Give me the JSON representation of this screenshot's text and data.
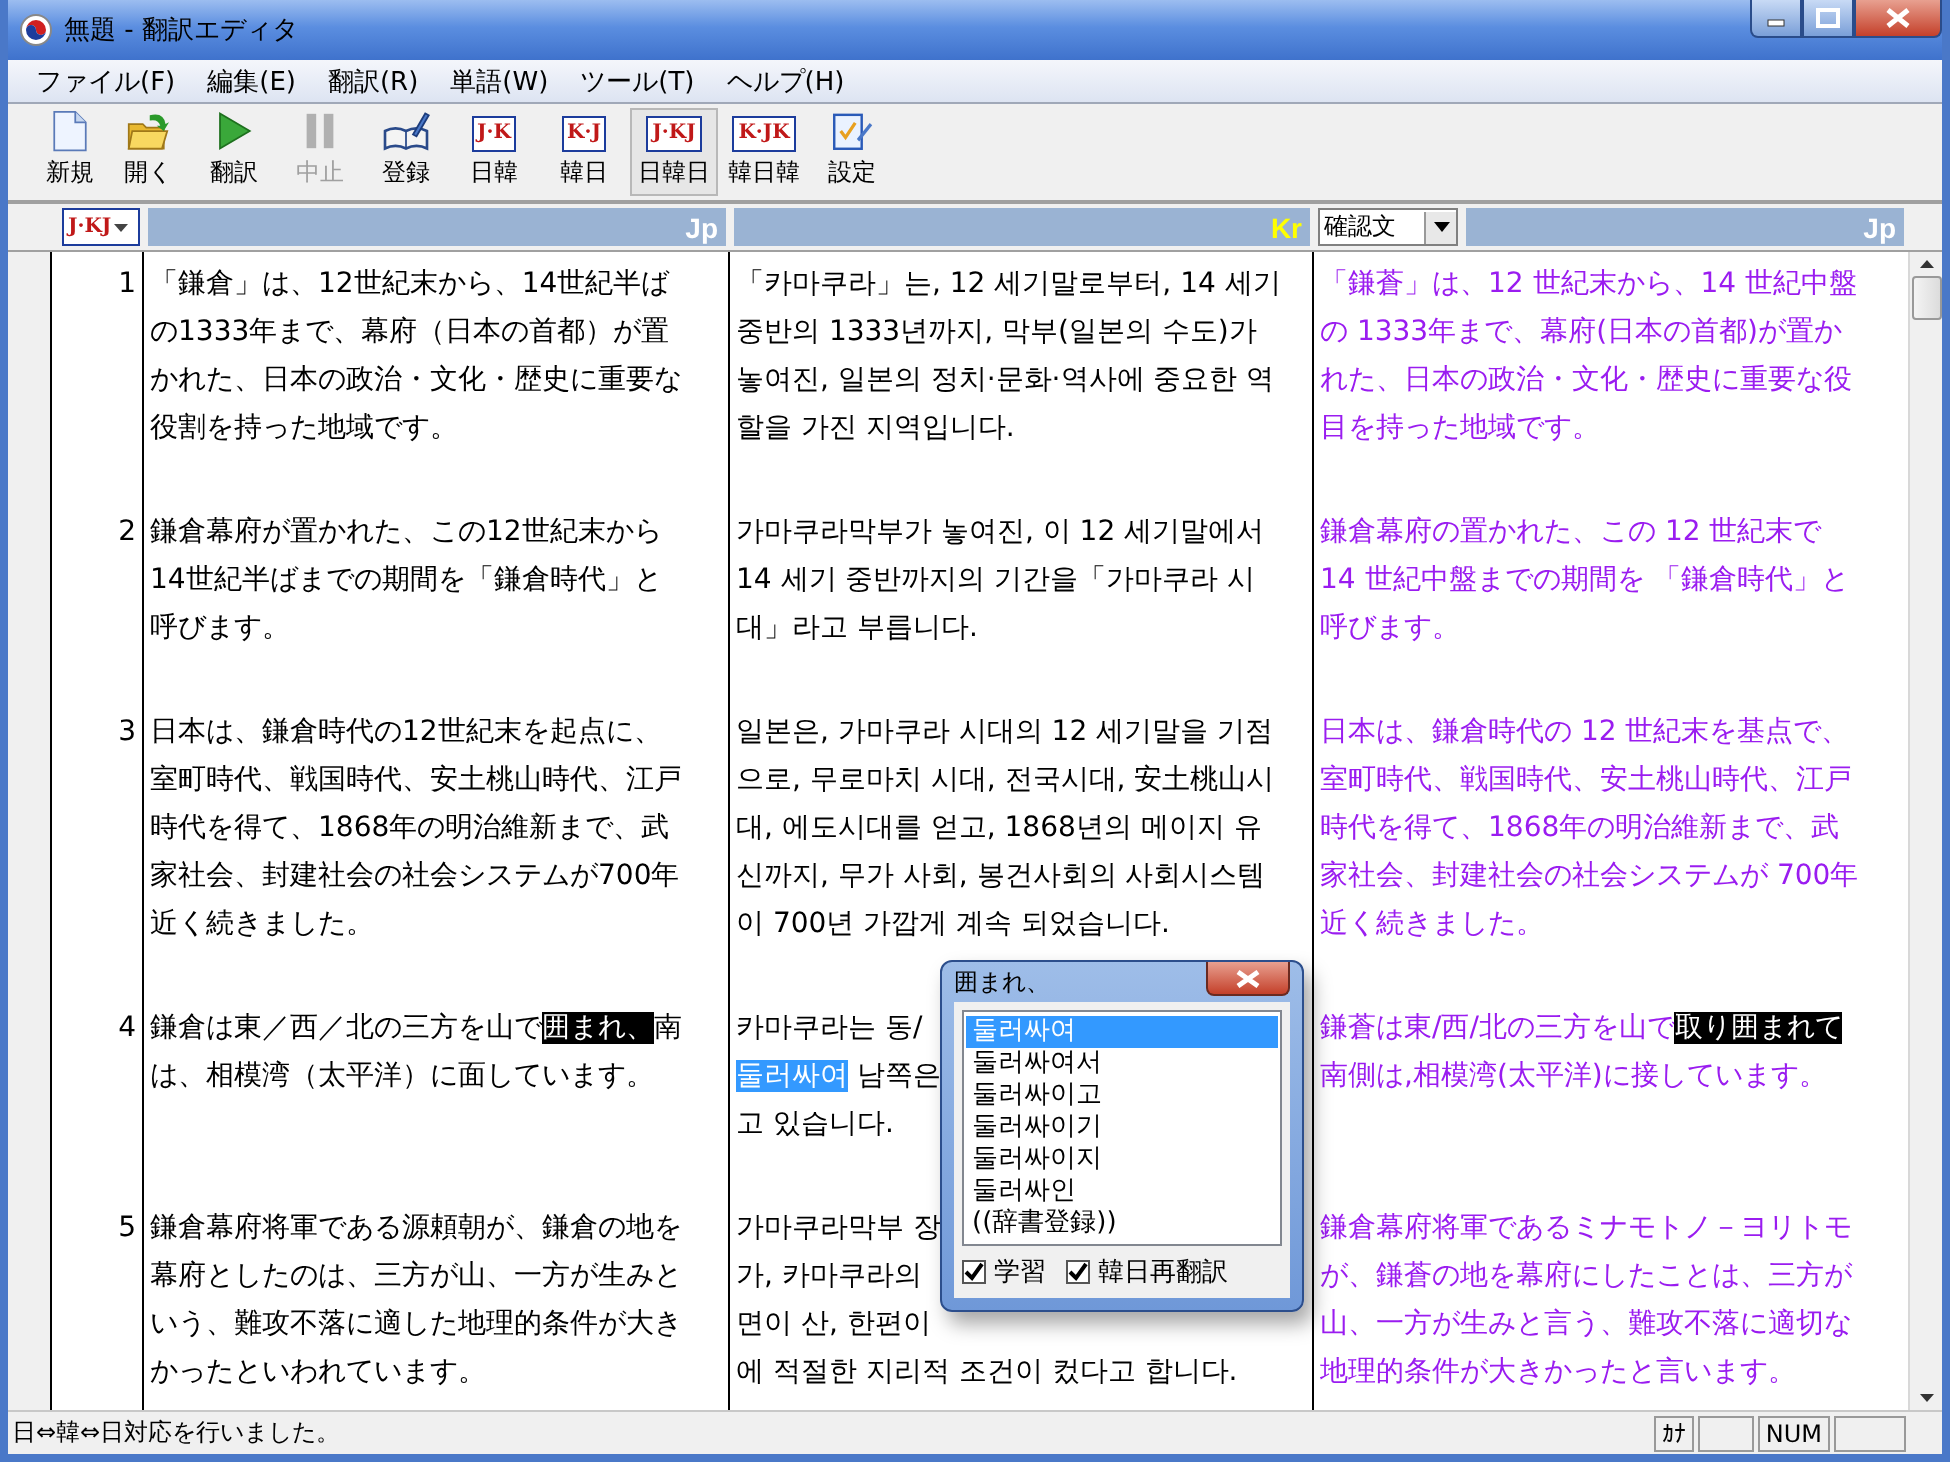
{
  "window": {
    "title": "無題 - 翻訳エディタ"
  },
  "menu": [
    "ファイル(F)",
    "編集(E)",
    "翻訳(R)",
    "単語(W)",
    "ツール(T)",
    "ヘルプ(H)"
  ],
  "toolbar": [
    {
      "label": "新規",
      "kind": "new",
      "disabled": false,
      "selected": false
    },
    {
      "label": "開く",
      "kind": "open",
      "disabled": false,
      "selected": false
    },
    {
      "label": "翻訳",
      "kind": "play",
      "disabled": false,
      "selected": false
    },
    {
      "label": "中止",
      "kind": "pause",
      "disabled": true,
      "selected": false
    },
    {
      "label": "登録",
      "kind": "book",
      "disabled": false,
      "selected": false
    },
    {
      "label": "日韓",
      "kind": "badge",
      "badge": "J·K",
      "disabled": false,
      "selected": false
    },
    {
      "label": "韓日",
      "kind": "badge",
      "badge": "K·J",
      "disabled": false,
      "selected": false
    },
    {
      "label": "日韓日",
      "kind": "badge",
      "badge": "J·KJ",
      "disabled": false,
      "selected": true
    },
    {
      "label": "韓日韓",
      "kind": "badge",
      "badge": "K·JK",
      "disabled": false,
      "selected": false
    },
    {
      "label": "設定",
      "kind": "settings",
      "disabled": false,
      "selected": false
    }
  ],
  "header": {
    "mode": "J·KJ",
    "source_label": "Jp",
    "middle_label": "Kr",
    "check_mode": "確認文",
    "target_label": "Jp"
  },
  "rows": [
    {
      "number": "1",
      "source": [
        "「鎌倉」は、12世紀末から、14世紀半ば",
        "の1333年まで、幕府（日本の首都）が置",
        "かれた、日本の政治・文化・歴史に重要な",
        "役割を持った地域です。"
      ],
      "middle": [
        "「카마쿠라」는, 12 세기말로부터, 14 세기",
        "중반의 1333년까지, 막부(일본의 수도)가",
        "놓여진, 일본의 정치·문화·역사에 중요한 역",
        "할을 가진 지역입니다."
      ],
      "target": [
        "「鎌蒼」は、12 世紀末から、14 世紀中盤",
        "の 1333年まで、幕府(日本の首都)が置か",
        "れた、日本の政治・文化・歴史に重要な役",
        "目を持った地域です。"
      ]
    },
    {
      "number": "2",
      "source": [
        "鎌倉幕府が置かれた、この12世紀末から",
        "14世紀半ばまでの期間を「鎌倉時代」と",
        "呼びます。"
      ],
      "middle": [
        "가마쿠라막부가 놓여진, 이 12 세기말에서",
        "14 세기 중반까지의 기간을「가마쿠라 시",
        "대」라고 부릅니다."
      ],
      "target": [
        "鎌倉幕府の置かれた、この 12 世紀末で",
        "14 世紀中盤までの期間を 「鎌倉時代」と",
        "呼びます。"
      ]
    },
    {
      "number": "3",
      "source": [
        "日本は、鎌倉時代の12世紀末を起点に、",
        "室町時代、戦国時代、安土桃山時代、江戸",
        "時代を得て、1868年の明治維新まで、武",
        "家社会、封建社会の社会システムが700年",
        "近く続きました。"
      ],
      "middle": [
        "일본은, 가마쿠라 시대의 12 세기말을 기점",
        "으로, 무로마치 시대, 전국시대, 安土桃山시",
        "대, 에도시대를 얻고, 1868년의 메이지 유",
        "신까지, 무가 사회, 봉건사회의 사회시스템",
        "이 700년 가깝게 계속 되었습니다."
      ],
      "target": [
        "日本は、鎌倉時代の 12 世紀末を基点で、",
        "室町時代、戦国時代、安土桃山時代、江戸",
        "時代を得て、1868年の明治維新まで、武",
        "家社会、封建社会の社会システムが 700年",
        "近く続きました。"
      ]
    },
    {
      "number": "4",
      "source": [
        [
          {
            "text": "鎌倉は東／西／北の三方を山で",
            "kind": "plain"
          },
          {
            "text": "囲まれ、",
            "kind": "focus"
          },
          {
            "text": "南",
            "kind": "plain"
          }
        ],
        "は、相模湾（太平洋）に面しています。"
      ],
      "middle": [
        "카마쿠라는 동/",
        [
          {
            "text": "둘러싸여",
            "kind": "selection"
          },
          {
            "text": " 남쪽은",
            "kind": "plain"
          }
        ],
        "고 있습니다."
      ],
      "target": [
        [
          {
            "text": "鎌蒼は東/西/北の三方を山で",
            "kind": "plain"
          },
          {
            "text": "取り囲まれて",
            "kind": "focus"
          }
        ],
        "南側は,相模湾(太平洋)に接しています。"
      ]
    },
    {
      "number": "5",
      "source": [
        "鎌倉幕府将軍である源頼朝が、鎌倉の地を",
        "幕府としたのは、三方が山、一方が生みと",
        "いう、難攻不落に適した地理的条件が大き",
        "かったといわれています。"
      ],
      "middle": [
        "가마쿠라막부 장",
        "가, 카마쿠라의",
        "면이 산, 한편이",
        "에 적절한 지리적 조건이 컸다고 합니다."
      ],
      "target": [
        "鎌倉幕府将軍であるミナモトノ－ヨリトモ",
        "が、鎌蒼の地を幕府にしたことは、三方が",
        "山、一方が生みと言う、難攻不落に適切な",
        "地理的条件が大きかったと言います。"
      ]
    }
  ],
  "popup": {
    "title": "囲まれ、",
    "candidates": [
      {
        "text": "둘러싸여",
        "selected": true
      },
      {
        "text": "둘러싸여서",
        "selected": false
      },
      {
        "text": "둘러싸이고",
        "selected": false
      },
      {
        "text": "둘러싸이기",
        "selected": false
      },
      {
        "text": "둘러싸이지",
        "selected": false
      },
      {
        "text": "둘러싸인",
        "selected": false
      },
      {
        "text": "((辞書登録))",
        "selected": false
      }
    ],
    "options": [
      {
        "label": "学習",
        "checked": true
      },
      {
        "label": "韓日再翻訳",
        "checked": true
      }
    ]
  },
  "status_bar": {
    "message": "日⇔韓⇔日対応を行いました。",
    "indicators": [
      {
        "text": "ｶﾅ"
      },
      {
        "text": "NUM"
      }
    ]
  }
}
